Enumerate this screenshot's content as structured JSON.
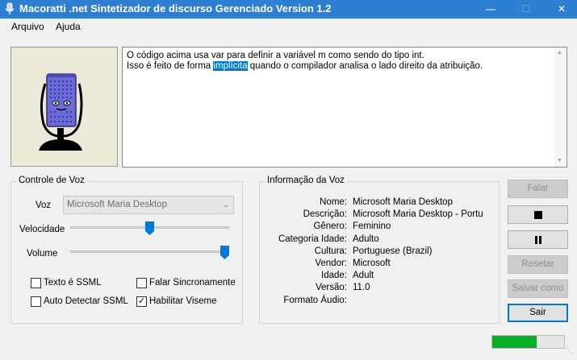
{
  "window": {
    "title": "Macoratti .net Sintetizador de discurso Gerenciado Version 1.2",
    "minimize_glyph": "—",
    "maximize_glyph": "☐",
    "close_glyph": "✕"
  },
  "menu": {
    "items": [
      "Arquivo",
      "Ajuda"
    ]
  },
  "text_editor": {
    "line1": "O código acima usa var para definir a variável m como sendo do tipo int.",
    "line2_before": "Isso é feito de forma ",
    "line2_selected": "implícita",
    "line2_after": " quando o compilador analisa o lado direito da atribuição."
  },
  "voice_control": {
    "title": "Controle de Voz",
    "voice_label": "Voz",
    "voice_value": "Microsoft Maria Desktop",
    "speed_label": "Velocidade",
    "speed_level": 0.5,
    "volume_label": "Volume",
    "volume_level": 1.0,
    "checkboxes": [
      {
        "label": "Texto é SSML",
        "checked": false
      },
      {
        "label": "Falar Sincronamente",
        "checked": false
      },
      {
        "label": "Auto Detectar SSML",
        "checked": false
      },
      {
        "label": "Habilitar Viseme",
        "checked": true
      }
    ]
  },
  "voice_info": {
    "title": "Informação da Voz",
    "rows": [
      {
        "key": "Nome:",
        "value": "Microsoft Maria Desktop"
      },
      {
        "key": "Descrição:",
        "value": "Microsoft Maria Desktop - Portu"
      },
      {
        "key": "Gênero:",
        "value": "Feminino"
      },
      {
        "key": "Categoria Idade:",
        "value": "Adulto"
      },
      {
        "key": "Cultura:",
        "value": "Portuguese (Brazil)"
      },
      {
        "key": "Vendor:",
        "value": "Microsoft"
      },
      {
        "key": "Idade:",
        "value": "Adult"
      },
      {
        "key": "Versão:",
        "value": "11.0"
      },
      {
        "key": "Formato Áudio:",
        "value": ""
      }
    ]
  },
  "buttons": {
    "speak": "Falar",
    "stop_icon": "stop-icon",
    "pause_icon": "pause-icon",
    "reset": "Resetar",
    "save_as": "Salvar como ..",
    "exit": "Sair"
  },
  "progress": {
    "fraction": 0.62
  },
  "colors": {
    "titlebar": "#2d7fd3",
    "selection": "#0078d7",
    "progress_fill": "#06b025",
    "avatar_body": "#6b6bd8",
    "avatar_bg": "#ece9d8"
  }
}
